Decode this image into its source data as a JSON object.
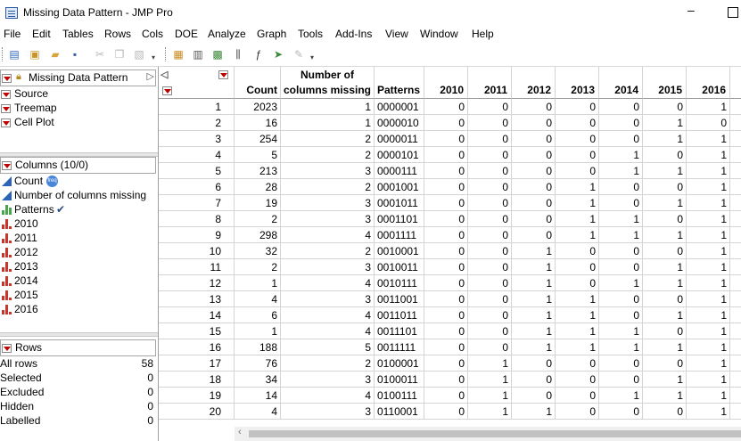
{
  "window": {
    "title": "Missing Data Pattern - JMP Pro",
    "minimize": "–"
  },
  "menu": [
    "File",
    "Edit",
    "Tables",
    "Rows",
    "Cols",
    "DOE",
    "Analyze",
    "Graph",
    "Tools",
    "Add-Ins",
    "View",
    "Window",
    "Help"
  ],
  "toolbar_icons": [
    "new-table-icon",
    "open-icon",
    "open-folder-icon",
    "save-icon",
    "cut-icon",
    "copy-icon",
    "paste-icon",
    "data-table-icon",
    "table-list-icon",
    "grid-icon",
    "column-info-icon",
    "formula-icon",
    "arrow-icon",
    "annotate-icon"
  ],
  "table_panel": {
    "title": "Missing Data Pattern",
    "scripts": [
      "Source",
      "Treemap",
      "Cell Plot"
    ]
  },
  "columns_panel": {
    "title": "Columns (10/0)",
    "columns": [
      {
        "name": "Count",
        "type": "continuous",
        "badge": "freq"
      },
      {
        "name": "Number of columns missing",
        "type": "continuous"
      },
      {
        "name": "Patterns",
        "type": "nominal",
        "badge": "check"
      },
      {
        "name": "2010",
        "type": "ordinal"
      },
      {
        "name": "2011",
        "type": "ordinal"
      },
      {
        "name": "2012",
        "type": "ordinal"
      },
      {
        "name": "2013",
        "type": "ordinal"
      },
      {
        "name": "2014",
        "type": "ordinal"
      },
      {
        "name": "2015",
        "type": "ordinal"
      },
      {
        "name": "2016",
        "type": "ordinal"
      }
    ],
    "freq_badge_text": "freq",
    "check_mark": "✔"
  },
  "rows_panel": {
    "title": "Rows",
    "stats": [
      {
        "label": "All rows",
        "value": "58"
      },
      {
        "label": "Selected",
        "value": "0"
      },
      {
        "label": "Excluded",
        "value": "0"
      },
      {
        "label": "Hidden",
        "value": "0"
      },
      {
        "label": "Labelled",
        "value": "0"
      }
    ]
  },
  "grid": {
    "headers": {
      "count": "Count",
      "ncm_line1": "Number of",
      "ncm_line2": "columns missing",
      "patterns": "Patterns",
      "years": [
        "2010",
        "2011",
        "2012",
        "2013",
        "2014",
        "2015",
        "2016"
      ]
    },
    "rows": [
      [
        "1",
        "2023",
        "1",
        "0000001",
        "0",
        "0",
        "0",
        "0",
        "0",
        "0",
        "1"
      ],
      [
        "2",
        "16",
        "1",
        "0000010",
        "0",
        "0",
        "0",
        "0",
        "0",
        "1",
        "0"
      ],
      [
        "3",
        "254",
        "2",
        "0000011",
        "0",
        "0",
        "0",
        "0",
        "0",
        "1",
        "1"
      ],
      [
        "4",
        "5",
        "2",
        "0000101",
        "0",
        "0",
        "0",
        "0",
        "1",
        "0",
        "1"
      ],
      [
        "5",
        "213",
        "3",
        "0000111",
        "0",
        "0",
        "0",
        "0",
        "1",
        "1",
        "1"
      ],
      [
        "6",
        "28",
        "2",
        "0001001",
        "0",
        "0",
        "0",
        "1",
        "0",
        "0",
        "1"
      ],
      [
        "7",
        "19",
        "3",
        "0001011",
        "0",
        "0",
        "0",
        "1",
        "0",
        "1",
        "1"
      ],
      [
        "8",
        "2",
        "3",
        "0001101",
        "0",
        "0",
        "0",
        "1",
        "1",
        "0",
        "1"
      ],
      [
        "9",
        "298",
        "4",
        "0001111",
        "0",
        "0",
        "0",
        "1",
        "1",
        "1",
        "1"
      ],
      [
        "10",
        "32",
        "2",
        "0010001",
        "0",
        "0",
        "1",
        "0",
        "0",
        "0",
        "1"
      ],
      [
        "11",
        "2",
        "3",
        "0010011",
        "0",
        "0",
        "1",
        "0",
        "0",
        "1",
        "1"
      ],
      [
        "12",
        "1",
        "4",
        "0010111",
        "0",
        "0",
        "1",
        "0",
        "1",
        "1",
        "1"
      ],
      [
        "13",
        "4",
        "3",
        "0011001",
        "0",
        "0",
        "1",
        "1",
        "0",
        "0",
        "1"
      ],
      [
        "14",
        "6",
        "4",
        "0011011",
        "0",
        "0",
        "1",
        "1",
        "0",
        "1",
        "1"
      ],
      [
        "15",
        "1",
        "4",
        "0011101",
        "0",
        "0",
        "1",
        "1",
        "1",
        "0",
        "1"
      ],
      [
        "16",
        "188",
        "5",
        "0011111",
        "0",
        "0",
        "1",
        "1",
        "1",
        "1",
        "1"
      ],
      [
        "17",
        "76",
        "2",
        "0100001",
        "0",
        "1",
        "0",
        "0",
        "0",
        "0",
        "1"
      ],
      [
        "18",
        "34",
        "3",
        "0100011",
        "0",
        "1",
        "0",
        "0",
        "0",
        "1",
        "1"
      ],
      [
        "19",
        "14",
        "4",
        "0100111",
        "0",
        "1",
        "0",
        "0",
        "1",
        "1",
        "1"
      ],
      [
        "20",
        "4",
        "3",
        "0110001",
        "0",
        "1",
        "1",
        "0",
        "0",
        "0",
        "1"
      ]
    ]
  }
}
